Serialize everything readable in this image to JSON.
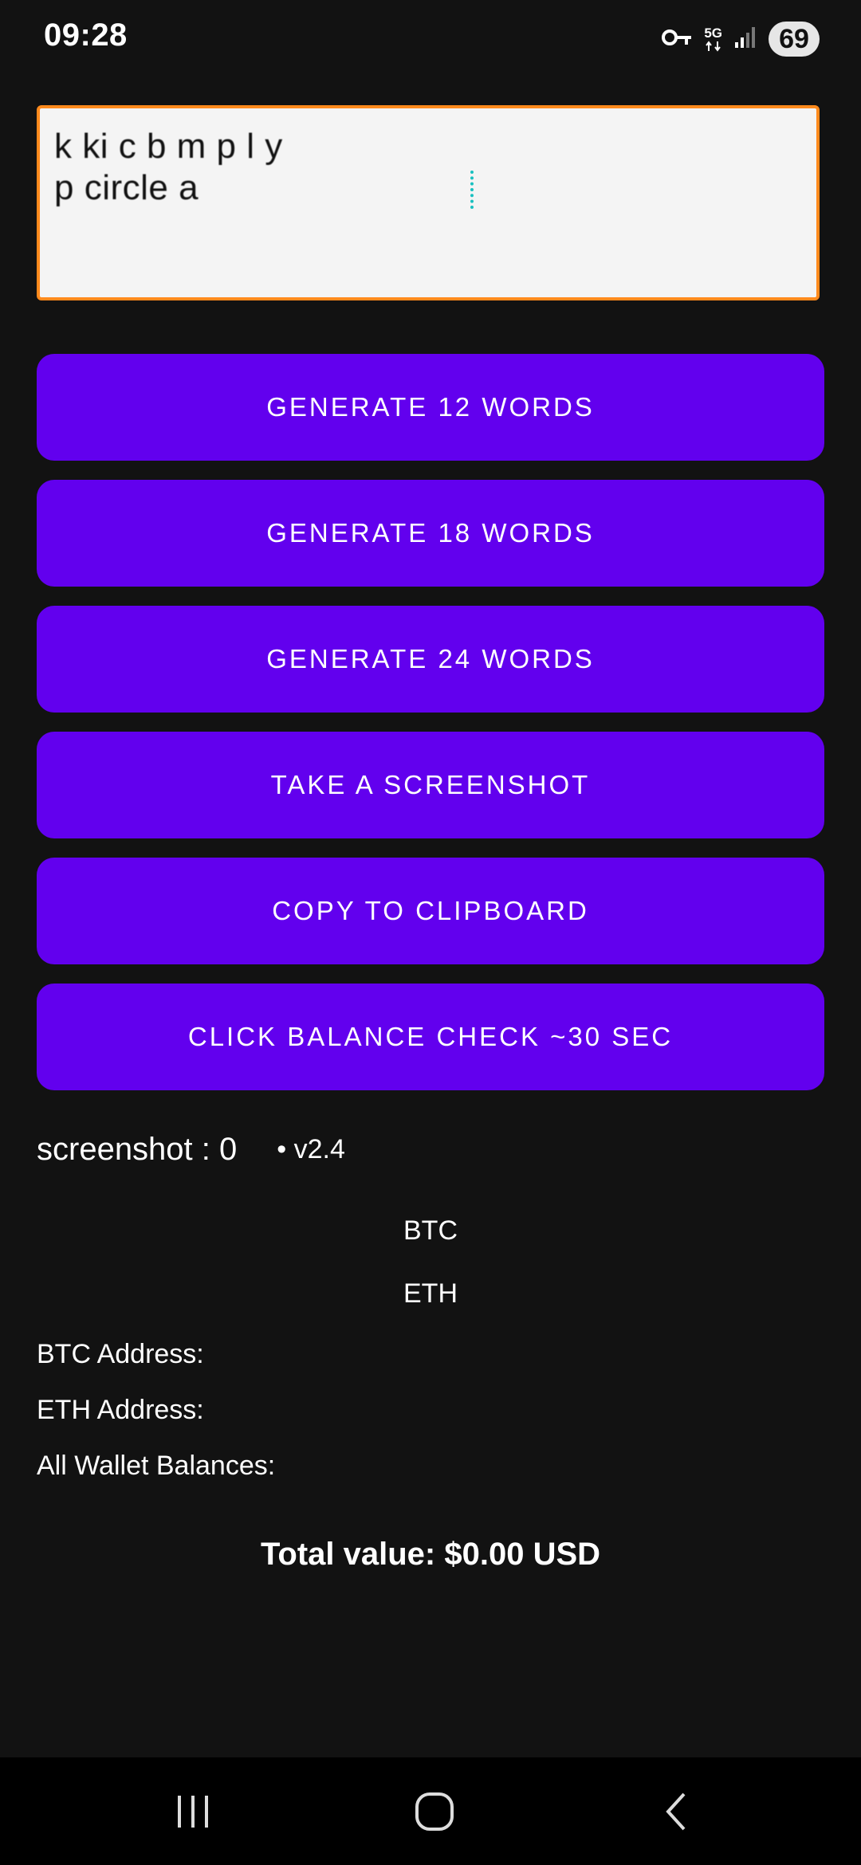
{
  "status_bar": {
    "time": "09:28",
    "network": "5G",
    "battery": "69",
    "icons": [
      "key-icon",
      "network-5g-icon",
      "signal-icon",
      "battery-icon"
    ]
  },
  "seed_input": {
    "line1": "k   ki   c   b    m   p   l   y",
    "line2": "p   circle a        "
  },
  "buttons": {
    "gen12": "GENERATE 12 WORDS",
    "gen18": "GENERATE 18 WORDS",
    "gen24": "GENERATE 24 WORDS",
    "screenshot": "TAKE A SCREENSHOT",
    "copy": "COPY TO CLIPBOARD",
    "balance": "CLICK BALANCE CHECK ~30 SEC"
  },
  "info": {
    "screenshot_count": "screenshot  : 0",
    "version": "• v2.4",
    "btc": "BTC",
    "eth": "ETH",
    "btc_address": "BTC Address:",
    "eth_address": "ETH Address:",
    "all_balances": "All Wallet Balances:",
    "total_value": "Total value: $0.00 USD"
  },
  "colors": {
    "background": "#121212",
    "button": "#6200ee",
    "input_border": "#ff8a1c",
    "cursor": "#19c0c0"
  },
  "nav": {
    "icons": [
      "recents-icon",
      "home-icon",
      "back-icon"
    ]
  }
}
